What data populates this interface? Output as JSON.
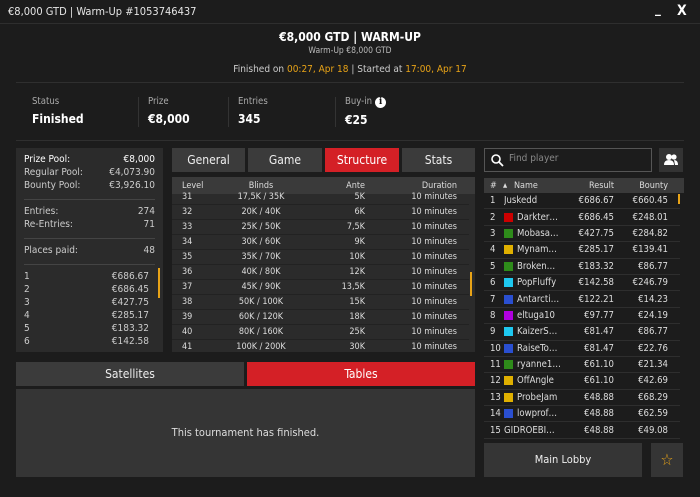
{
  "window": {
    "title": "€8,000 GTD  |  Warm-Up #1053746437",
    "minimize": "_",
    "close": "X"
  },
  "header": {
    "title": "€8,000 GTD  |  WARM-UP",
    "subtitle": "Warm-Up €8,000 GTD",
    "finished_label": "Finished on ",
    "finished_value": "00:27, Apr 18",
    "sep": "  |  ",
    "started_label": "Started at ",
    "started_value": "17:00, Apr 17"
  },
  "stats": [
    {
      "label": "Status",
      "value": "Finished"
    },
    {
      "label": "Prize",
      "value": "€8,000"
    },
    {
      "label": "Entries",
      "value": "345"
    },
    {
      "label": "Buy-in",
      "value": "€25",
      "icon": "info-icon"
    }
  ],
  "prize_panel": {
    "pool": [
      [
        "Prize Pool:",
        "€8,000"
      ],
      [
        "Regular Pool:",
        "€4,073.90"
      ],
      [
        "Bounty Pool:",
        "€3,926.10"
      ]
    ],
    "entries": [
      [
        "Entries:",
        "274"
      ],
      [
        "Re-Entries:",
        "71"
      ]
    ],
    "places": [
      "Places paid:",
      "48"
    ],
    "payouts": [
      [
        "1",
        "€686.67"
      ],
      [
        "2",
        "€686.45"
      ],
      [
        "3",
        "€427.75"
      ],
      [
        "4",
        "€285.17"
      ],
      [
        "5",
        "€183.32"
      ],
      [
        "6",
        "€142.58"
      ]
    ]
  },
  "tabs": [
    "General",
    "Game",
    "Structure",
    "Stats"
  ],
  "active_tab": "Structure",
  "structure": {
    "headers": [
      "Level",
      "Blinds",
      "Ante",
      "Duration"
    ],
    "rows": [
      [
        "31",
        "17,5K / 35K",
        "5K",
        "10 minutes"
      ],
      [
        "32",
        "20K / 40K",
        "6K",
        "10 minutes"
      ],
      [
        "33",
        "25K / 50K",
        "7,5K",
        "10 minutes"
      ],
      [
        "34",
        "30K / 60K",
        "9K",
        "10 minutes"
      ],
      [
        "35",
        "35K / 70K",
        "10K",
        "10 minutes"
      ],
      [
        "36",
        "40K / 80K",
        "12K",
        "10 minutes"
      ],
      [
        "37",
        "45K / 90K",
        "13,5K",
        "10 minutes"
      ],
      [
        "38",
        "50K / 100K",
        "15K",
        "10 minutes"
      ],
      [
        "39",
        "60K / 120K",
        "18K",
        "10 minutes"
      ],
      [
        "40",
        "80K / 160K",
        "25K",
        "10 minutes"
      ],
      [
        "41",
        "100K / 200K",
        "30K",
        "10 minutes"
      ]
    ]
  },
  "bottom_tabs": {
    "satellites": "Satellites",
    "tables": "Tables",
    "active": "Tables",
    "message": "This tournament has finished."
  },
  "players": {
    "search_placeholder": "Find player",
    "headers": [
      "#",
      "Name",
      "Result",
      "Bounty"
    ],
    "sort_icon": "▲",
    "rows": [
      [
        "1",
        "Juskedd",
        "€686.67",
        "€660.45",
        ""
      ],
      [
        "2",
        "Darkter…",
        "€686.45",
        "€248.01",
        "#cc0000"
      ],
      [
        "3",
        "Mobasa…",
        "€427.75",
        "€284.82",
        "#2e8b1a"
      ],
      [
        "4",
        "Mynam…",
        "€285.17",
        "€139.41",
        "#e0b000"
      ],
      [
        "5",
        "Broken…",
        "€183.32",
        "€86.77",
        "#2e8b1a"
      ],
      [
        "6",
        "PopFluffy",
        "€142.58",
        "€246.79",
        "#1ec8f0"
      ],
      [
        "7",
        "Antarcti…",
        "€122.21",
        "€14.23",
        "#2a4fd0"
      ],
      [
        "8",
        "eltuga10",
        "€97.77",
        "€24.19",
        "#b000e0"
      ],
      [
        "9",
        "KaizerS…",
        "€81.47",
        "€86.77",
        "#1ec8f0"
      ],
      [
        "10",
        "RaiseTo…",
        "€81.47",
        "€22.76",
        "#2a4fd0"
      ],
      [
        "11",
        "ryanne1…",
        "€61.10",
        "€21.34",
        "#2e8b1a"
      ],
      [
        "12",
        "OffAngle",
        "€61.10",
        "€42.69",
        "#e0b000"
      ],
      [
        "13",
        "ProbeJam",
        "€48.88",
        "€68.29",
        "#e0b000"
      ],
      [
        "14",
        "lowprof…",
        "€48.88",
        "€62.59",
        "#2a4fd0"
      ],
      [
        "15",
        "GIDROEBI…",
        "€48.88",
        "€49.08",
        ""
      ]
    ]
  },
  "main_lobby": "Main Lobby",
  "colors": {
    "accent": "#d42026",
    "highlight": "#e8a317"
  }
}
